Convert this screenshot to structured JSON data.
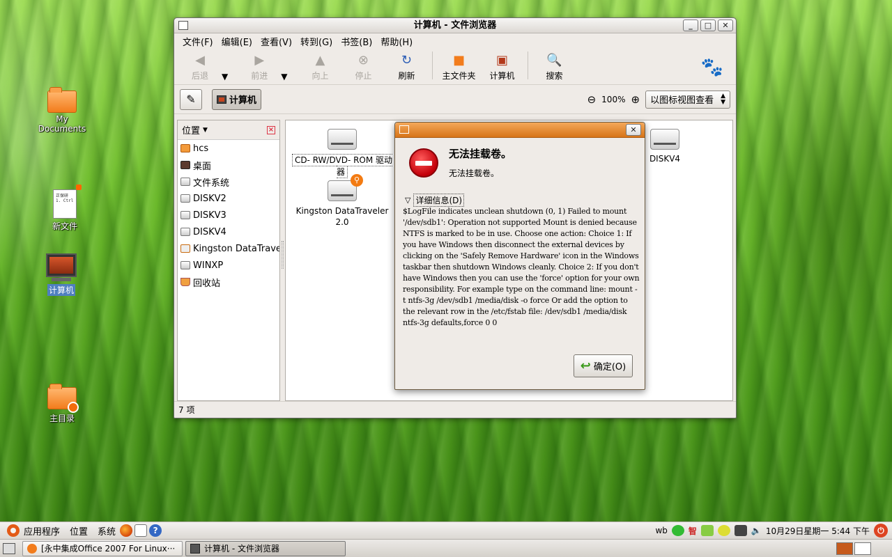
{
  "desktop": {
    "icons": [
      {
        "label": "My Documents"
      },
      {
        "label": "新文件",
        "doc_preview": "正保研\n1. Ctrl"
      },
      {
        "label": "计算机"
      },
      {
        "label": "主目录"
      }
    ]
  },
  "window": {
    "title": "计算机 - 文件浏览器",
    "controls": {
      "minimize": "_",
      "maximize": "□",
      "close": "✕"
    },
    "menu": [
      "文件(F)",
      "编辑(E)",
      "查看(V)",
      "转到(G)",
      "书签(B)",
      "帮助(H)"
    ],
    "toolbar": {
      "back": "后退",
      "forward": "前进",
      "up": "向上",
      "stop": "停止",
      "reload": "刷新",
      "home": "主文件夹",
      "computer": "计算机",
      "search": "搜索"
    },
    "location": {
      "crumb": "计算机",
      "zoom": "100%",
      "view": "以图标视图查看"
    },
    "sidebar": {
      "header": "位置",
      "items": [
        "hcs",
        "桌面",
        "文件系统",
        "DISKV2",
        "DISKV3",
        "DISKV4",
        "Kingston DataTraveler",
        "WINXP",
        "回收站"
      ]
    },
    "files": [
      {
        "label": "CD- RW/DVD- ROM 驱动器"
      },
      {
        "label": "Kingston DataTraveler\n2.0"
      },
      {
        "label": "DISKV4"
      }
    ],
    "status": "7 项"
  },
  "dialog": {
    "primary": "无法挂载卷。",
    "secondary": "无法挂载卷。",
    "details_label": "详细信息(D)",
    "details_text": "$LogFile indicates unclean shutdown (0, 1) Failed to mount '/dev/sdb1': Operation not supported Mount is denied because NTFS is marked to be in use. Choose one action: Choice 1: If you have Windows then disconnect the external devices by clicking on the 'Safely Remove Hardware' icon in the Windows taskbar then shutdown Windows cleanly. Choice 2: If you don't have Windows then you can use the 'force' option for your own responsibility. For example type on the command line: mount -t ntfs-3g /dev/sdb1 /media/disk -o force Or add the option to the relevant row in the /etc/fstab file: /dev/sdb1 /media/disk ntfs-3g defaults,force 0 0",
    "ok_label": "确定(O)"
  },
  "panel": {
    "menus": [
      "应用程序",
      "位置",
      "系统"
    ],
    "tray_user": "wb",
    "tray_ime": "智",
    "clock": "10月29日星期一 5:44 下午"
  },
  "taskbar": {
    "tasks": [
      "[永中集成Office 2007 For Linux···",
      "计算机 - 文件浏览器"
    ]
  },
  "colors": {
    "dialog_title": "#e0832a",
    "error": "#c3000a",
    "accent_orange": "#f27c1c"
  }
}
